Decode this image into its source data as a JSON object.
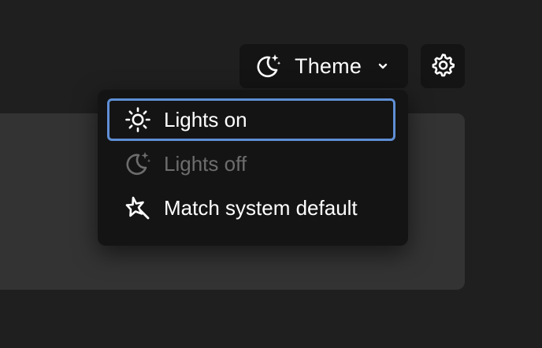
{
  "header": {
    "theme_button_label": "Theme",
    "theme_icon": "moon-sparkle-icon",
    "dropdown_icon": "chevron-down-icon",
    "settings_icon": "gear-icon"
  },
  "menu": {
    "items": [
      {
        "label": "Lights on",
        "icon": "sun-icon",
        "state": "focused"
      },
      {
        "label": "Lights off",
        "icon": "moon-sparkle-icon",
        "state": "disabled"
      },
      {
        "label": "Match system default",
        "icon": "magic-wand-icon",
        "state": "normal"
      }
    ]
  },
  "colors": {
    "background": "#1f1f1f",
    "surface": "#141414",
    "panel": "#333333",
    "focus_ring": "#5f8fd6",
    "text": "#ffffff",
    "disabled_text": "#6d6d6d"
  }
}
